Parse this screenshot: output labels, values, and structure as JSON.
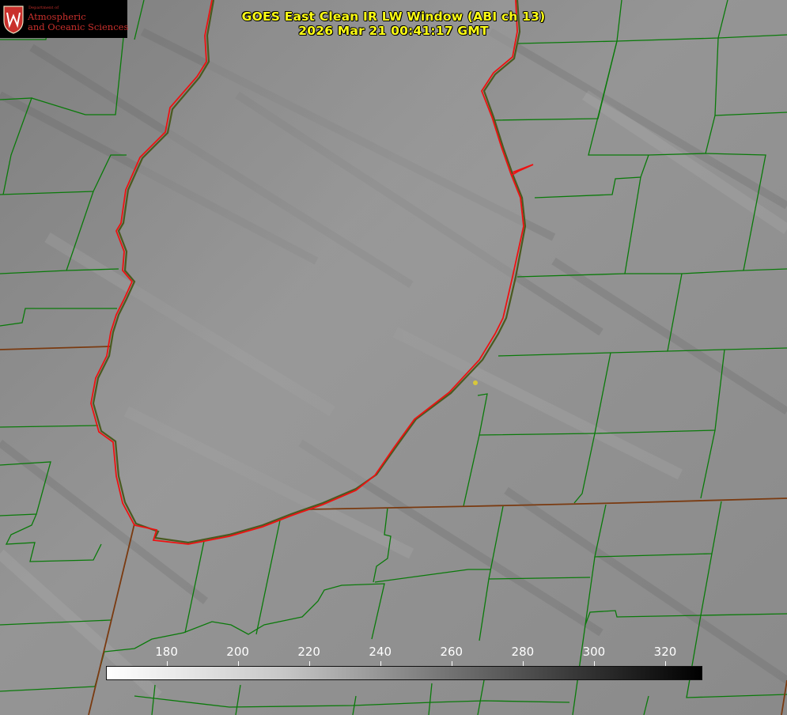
{
  "title": {
    "line1": "GOES East Clean IR LW Window (ABI ch 13)",
    "line2": "2026 Mar 21 00:41:17 GMT"
  },
  "logo": {
    "department": "Department of",
    "line1": "Atmospheric",
    "line2": "and Oceanic Sciences",
    "seal_letter": "W",
    "colors": {
      "text": "#c9302c",
      "background": "#000000"
    }
  },
  "colorbar": {
    "units_shown": "",
    "ticks": [
      "180",
      "200",
      "220",
      "240",
      "260",
      "280",
      "300",
      "320"
    ],
    "tick_values": [
      180,
      200,
      220,
      240,
      260,
      280,
      300,
      320
    ],
    "range": [
      163,
      330
    ],
    "colors": {
      "low": "#ffffff",
      "high": "#000000"
    }
  },
  "map": {
    "background": "#8f8f8f",
    "county_line_color": "#0a7a0a",
    "state_line_color": "#7a3a10",
    "lake_outline_color": "#ee1111",
    "station_marker_color": "#d8c83a"
  }
}
